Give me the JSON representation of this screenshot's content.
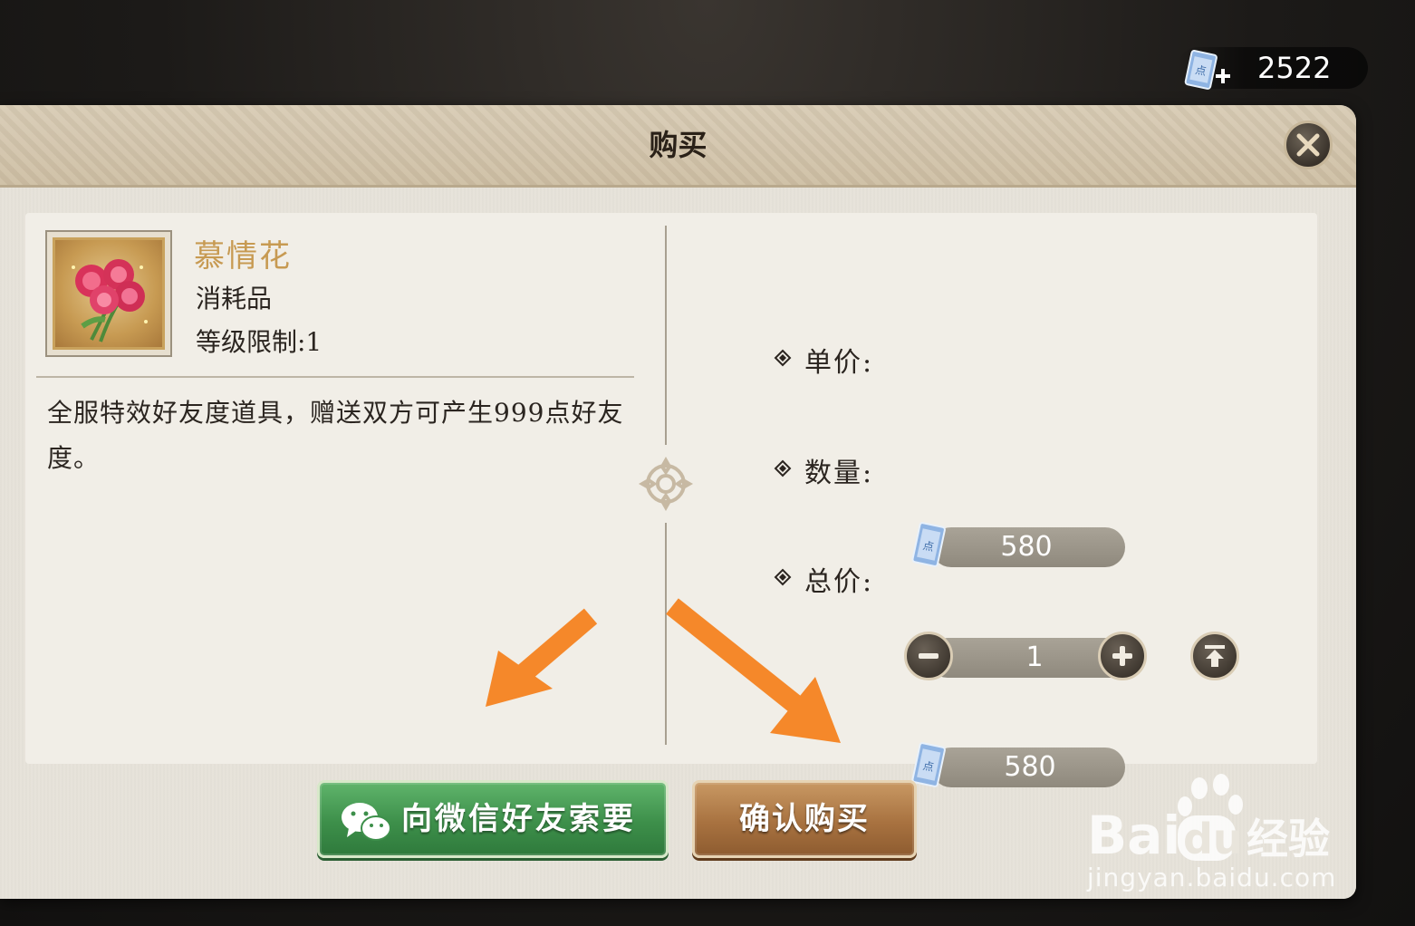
{
  "currency": {
    "icon": "ticket-icon",
    "value": "2522",
    "plus_icon": "plus-icon"
  },
  "dialog": {
    "title": "购买",
    "close_icon": "close-icon"
  },
  "item": {
    "name": "慕情花",
    "type": "消耗品",
    "level_limit": "等级限制:1",
    "description": "全服特效好友度道具，赠送双方可产生999点好友度。",
    "image": "rose-bouquet"
  },
  "purchase": {
    "unit_price_label": "单价:",
    "unit_price": "580",
    "quantity_label": "数量:",
    "quantity": "1",
    "total_label": "总价:",
    "total_price": "580"
  },
  "buttons": {
    "wechat": "向微信好友索要",
    "confirm": "确认购买"
  },
  "colors": {
    "wechat_button": "#3d8f4a",
    "confirm_button": "#a87240",
    "item_name": "#c79a52",
    "arrow": "#f5882a"
  },
  "watermark": {
    "brand": "Baidu经验",
    "url": "jingyan.baidu.com"
  }
}
